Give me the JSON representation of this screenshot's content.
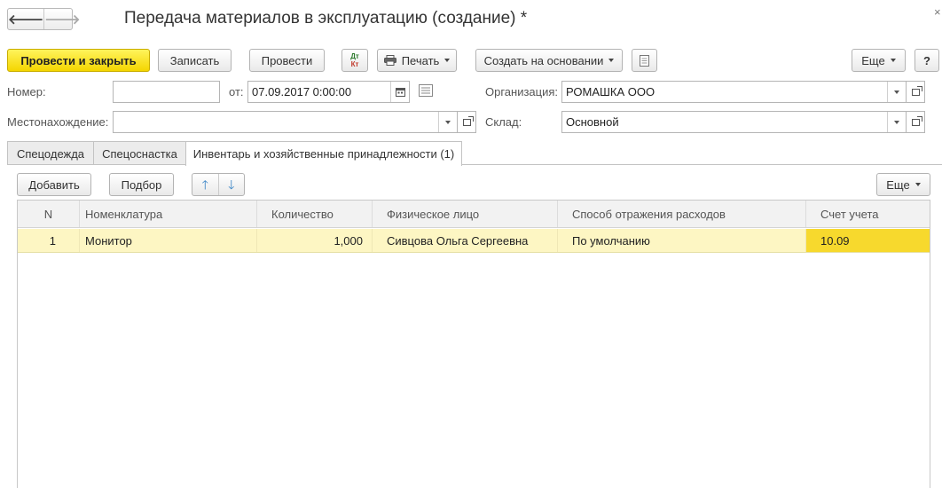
{
  "window": {
    "title": "Передача материалов в эксплуатацию (создание) *",
    "close_glyph": "×"
  },
  "nav": {
    "back_glyph": "🡐",
    "forward_glyph": "🡒"
  },
  "toolbar": {
    "post_close_label": "Провести и закрыть",
    "save_label": "Записать",
    "post_label": "Провести",
    "dt_kt_top": "Дт",
    "dt_kt_bottom": "Кт",
    "print_label": "Печать",
    "create_based_label": "Создать на основании",
    "more_label": "Еще",
    "help_label": "?"
  },
  "form": {
    "number_label": "Номер:",
    "number_value": "",
    "date_from_label": "от:",
    "date_value": "07.09.2017  0:00:00",
    "organization_label": "Организация:",
    "organization_value": "РОМАШКА ООО",
    "location_label": "Местонахождение:",
    "location_value": "",
    "warehouse_label": "Склад:",
    "warehouse_value": "Основной"
  },
  "tabs": [
    {
      "label": "Спецодежда"
    },
    {
      "label": "Спецоснастка"
    },
    {
      "label": "Инвентарь и хозяйственные принадлежности (1)"
    }
  ],
  "table_toolbar": {
    "add_label": "Добавить",
    "select_label": "Подбор",
    "move_up_glyph": "🡑",
    "move_down_glyph": "🡓",
    "more_label": "Еще"
  },
  "table": {
    "columns": [
      "N",
      "Номенклатура",
      "Количество",
      "Физическое лицо",
      "Способ отражения расходов",
      "Счет учета"
    ],
    "rows": [
      [
        "1",
        "Монитор",
        "1,000",
        "Сивцова Ольга Сергеевна",
        "По умолчанию",
        "10.09"
      ]
    ]
  },
  "colors": {
    "primary_button": "#f4d500",
    "selected_row": "#fdf6c3",
    "active_cell": "#f7d92d",
    "arrow_blue": "#3d86c6"
  }
}
